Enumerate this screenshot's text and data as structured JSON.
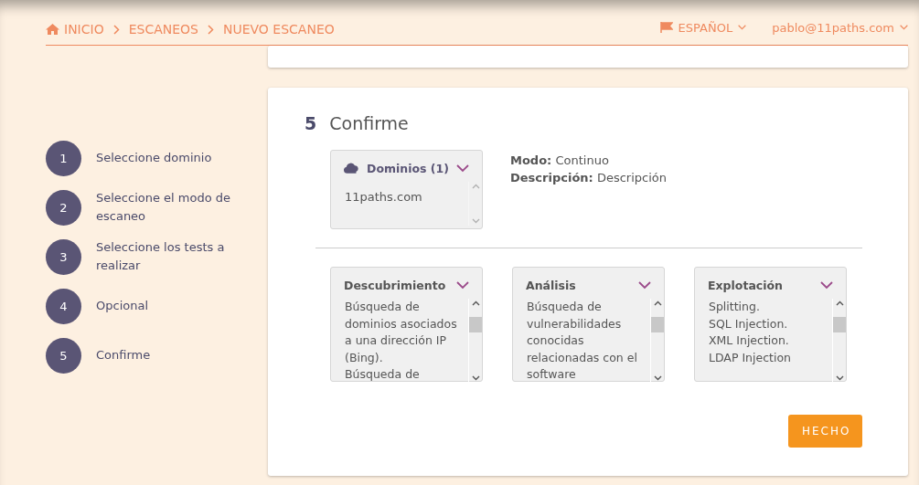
{
  "breadcrumb": [
    "INICIO",
    "ESCANEOS",
    "NUEVO ESCANEO"
  ],
  "language": "ESPAÑOL",
  "user": "pablo@11paths.com",
  "steps": [
    {
      "number": "1",
      "label": "Seleccione dominio"
    },
    {
      "number": "2",
      "label": "Seleccione el modo de escaneo"
    },
    {
      "number": "3",
      "label": "Seleccione los tests a realizar"
    },
    {
      "number": "4",
      "label": "Opcional"
    },
    {
      "number": "5",
      "label": "Confirme"
    }
  ],
  "section": {
    "number": "5",
    "title": "Confirme"
  },
  "domains": {
    "title": "Dominios (1)",
    "items": [
      "11paths.com"
    ]
  },
  "details": [
    {
      "label": "Modo:",
      "value": "Continuo"
    },
    {
      "label": "Descripción:",
      "value": "Descripción"
    }
  ],
  "tests": [
    {
      "title": "Descubrimiento",
      "lines": [
        "Búsqueda de",
        "dominios asociados",
        "a una dirección IP",
        "(Bing).",
        "Búsqueda de"
      ]
    },
    {
      "title": "Análisis",
      "lines": [
        "Búsqueda de",
        "vulnerabilidades",
        "conocidas",
        "relacionadas con el",
        "software"
      ]
    },
    {
      "title": "Explotación",
      "lines": [
        "Splitting.",
        "SQL Injection.",
        "XML Injection.",
        "LDAP Injection"
      ]
    }
  ],
  "done_button": "HECHO"
}
